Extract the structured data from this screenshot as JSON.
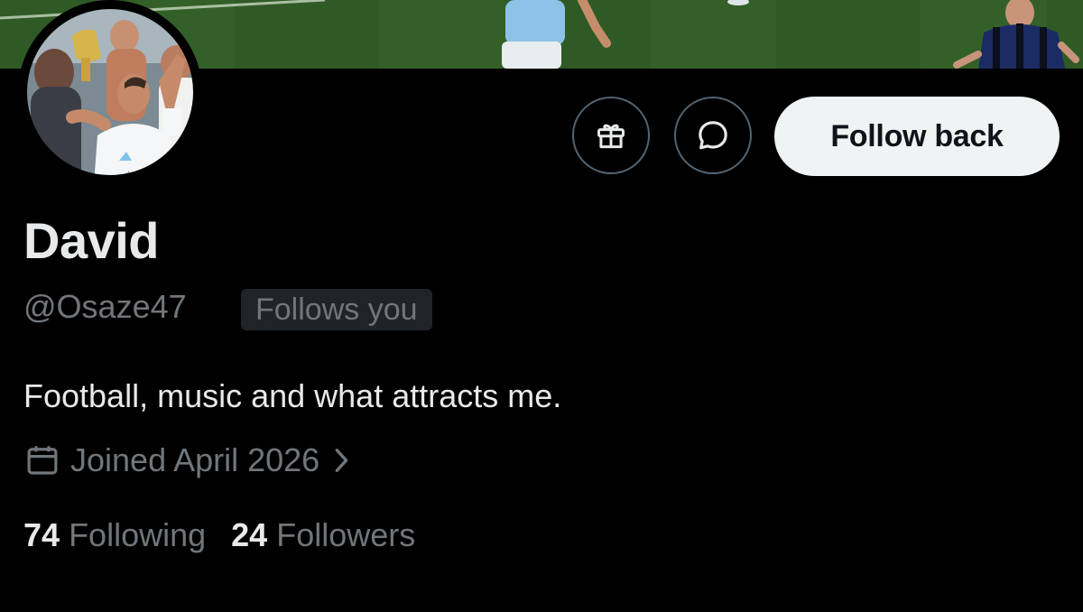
{
  "profile": {
    "display_name": "David",
    "handle": "@Osaze47",
    "follows_you_badge": "Follows you",
    "bio": "Football, music and what attracts me.",
    "joined": "Joined April 2026",
    "following_count": "74",
    "following_label": "Following",
    "followers_count": "24",
    "followers_label": "Followers"
  },
  "actions": {
    "gift_icon": "gift-icon",
    "message_icon": "message-bubble-icon",
    "follow_back_label": "Follow back"
  },
  "colors": {
    "background": "#000000",
    "primary_text": "#e7e9ea",
    "secondary_text": "#71767b",
    "button_border": "#536471",
    "follow_button_bg": "#eff3f4",
    "badge_bg": "#202327"
  }
}
